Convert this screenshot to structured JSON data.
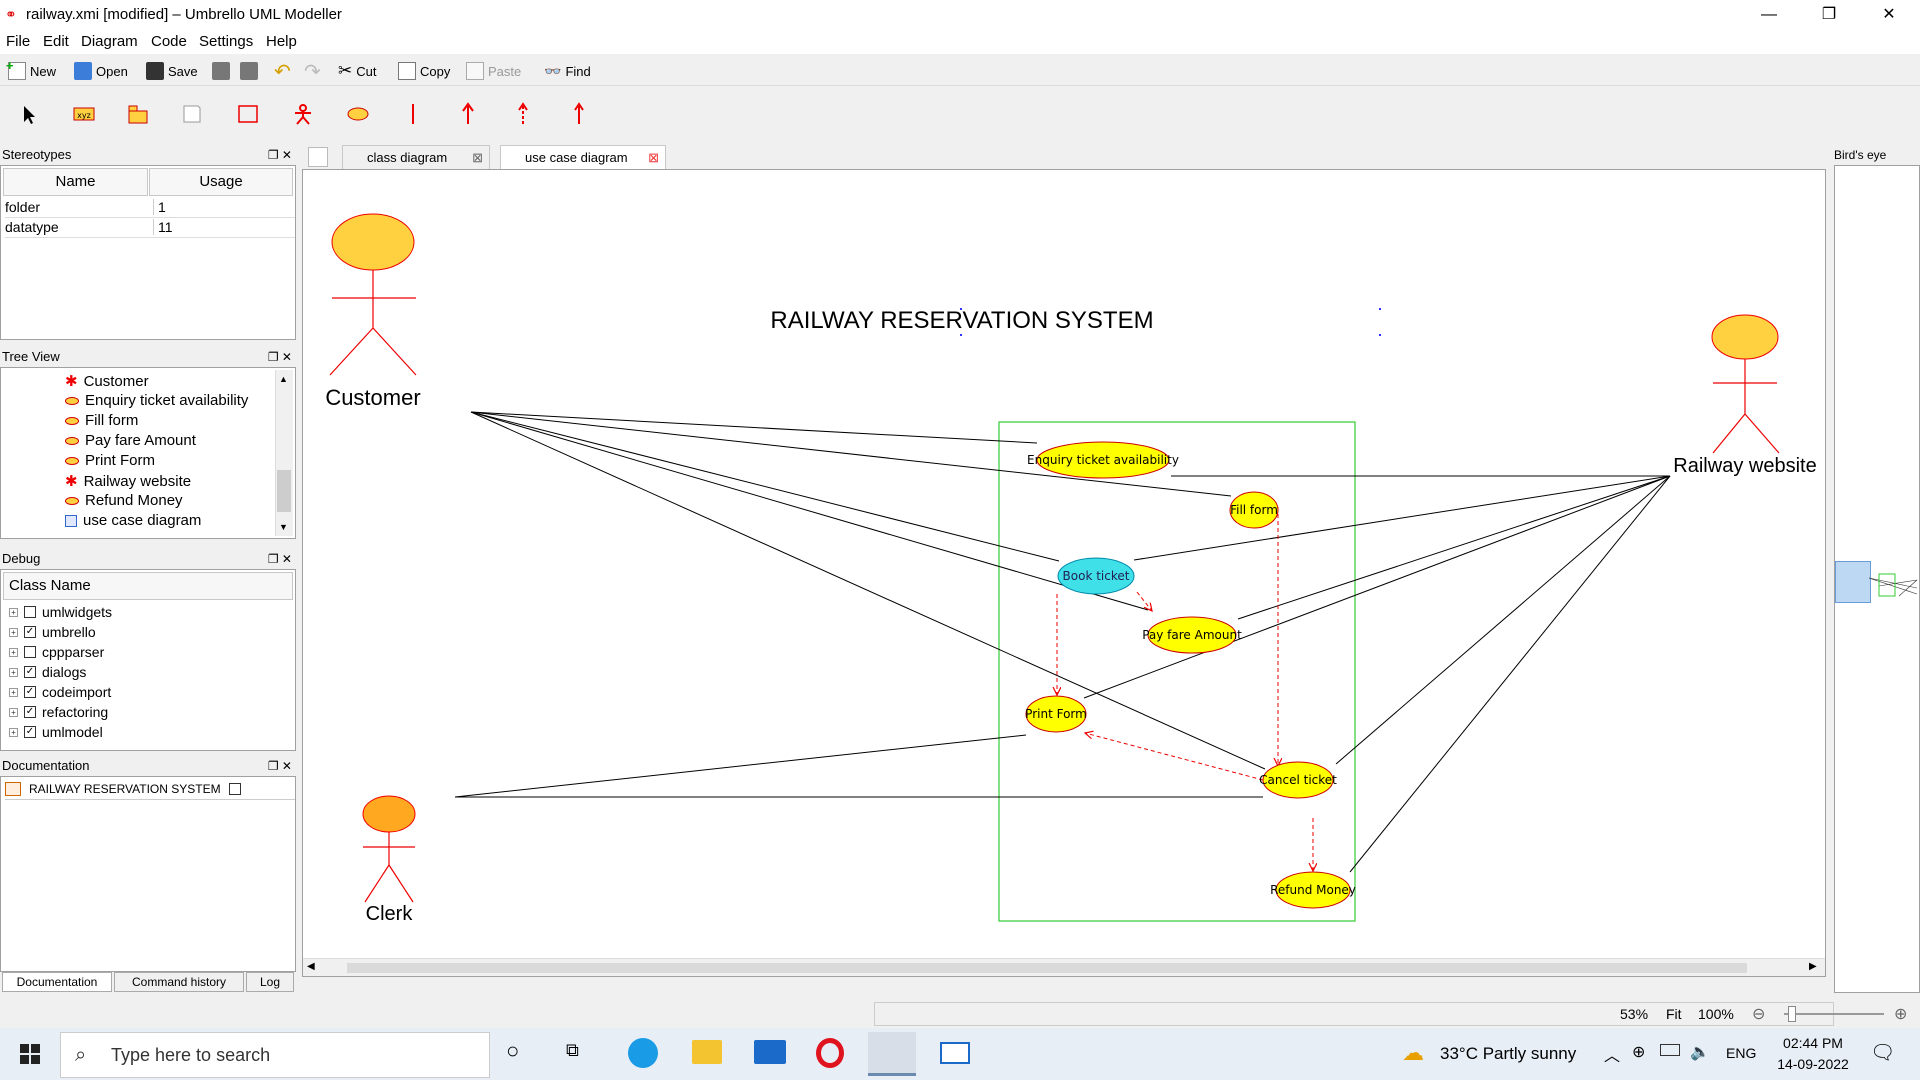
{
  "window": {
    "title": "railway.xmi [modified] – Umbrello UML Modeller"
  },
  "menu": [
    "File",
    "Edit",
    "Diagram",
    "Code",
    "Settings",
    "Help"
  ],
  "toolbar": {
    "new": "New",
    "open": "Open",
    "save": "Save",
    "cut": "Cut",
    "copy": "Copy",
    "paste": "Paste",
    "find": "Find"
  },
  "stereotypes": {
    "title": "Stereotypes",
    "col_name": "Name",
    "col_usage": "Usage",
    "rows": [
      {
        "name": "folder",
        "usage": "1"
      },
      {
        "name": "datatype",
        "usage": "11"
      }
    ]
  },
  "tree": {
    "title": "Tree View",
    "items": [
      "Customer",
      "Enquiry ticket availability",
      "Fill form",
      "Pay fare Amount",
      "Print Form",
      "Railway website",
      "Refund Money",
      "use case diagram"
    ]
  },
  "debug": {
    "title": "Debug",
    "col": "Class Name",
    "items": [
      {
        "label": "umlwidgets",
        "checked": false
      },
      {
        "label": "umbrello",
        "checked": true
      },
      {
        "label": "cppparser",
        "checked": false
      },
      {
        "label": "dialogs",
        "checked": true
      },
      {
        "label": "codeimport",
        "checked": true
      },
      {
        "label": "refactoring",
        "checked": true
      },
      {
        "label": "umlmodel",
        "checked": true
      }
    ]
  },
  "documentation": {
    "title": "Documentation",
    "item": "RAILWAY RESERVATION SYSTEM"
  },
  "bottom_tabs": [
    "Documentation",
    "Command history",
    "Log"
  ],
  "tabs": [
    "class diagram",
    "use case diagram"
  ],
  "birds_eye": {
    "title": "Bird's eye"
  },
  "diagram": {
    "title": "RAILWAY RESERVATION SYSTEM",
    "actors": {
      "customer": "Customer",
      "railway": "Railway website",
      "clerk": "Clerk"
    },
    "usecases": {
      "enquiry": "Enquiry ticket availability",
      "fill": "Fill form",
      "book": "Book ticket",
      "pay": "Pay fare Amount",
      "print": "Print Form",
      "cancel": "Cancel ticket",
      "refund": "Refund Money"
    }
  },
  "status": {
    "zoom": "53%",
    "fit": "Fit",
    "hundred": "100%"
  },
  "taskbar": {
    "search": "Type here to search",
    "weather": "33°C  Partly sunny",
    "lang": "ENG",
    "time": "02:44 PM",
    "date": "14-09-2022"
  },
  "colors": {
    "usecase": "#ffff00",
    "usecase_active": "#40e0e8",
    "actor_head": "#ffd040",
    "actor_line": "#ff0000",
    "boundary": "#33cc33"
  }
}
